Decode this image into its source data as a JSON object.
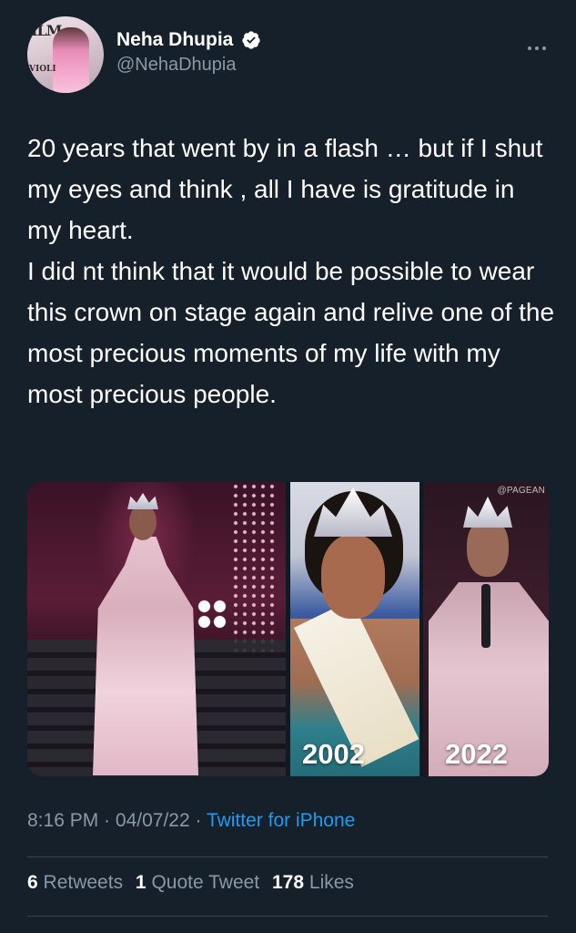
{
  "user": {
    "display_name": "Neha Dhupia",
    "handle": "@NehaDhupia",
    "avatar_cover_text": "ILM",
    "avatar_cover_sub": "VIOLI",
    "verified_icon": "verified-badge-icon",
    "more_icon": "more-horizontal-icon"
  },
  "tweet": {
    "paragraph1": "20 years that went by in a flash … but if I shut my eyes and think , all I have is gratitude in my heart.",
    "paragraph2": "I did nt think that it would be possible to wear this crown on stage again and relive one of the most precious moments of my life with my most precious people."
  },
  "media": {
    "watermark": "@PAGEAN",
    "year_left": "2002",
    "year_right": "2022"
  },
  "meta": {
    "time": "8:16 PM",
    "separator": " · ",
    "date": "04/07/22",
    "source": "Twitter for iPhone"
  },
  "stats": {
    "retweets_count": "6",
    "retweets_label": "Retweets",
    "quotes_count": "1",
    "quotes_label": "Quote Tweet",
    "likes_count": "178",
    "likes_label": "Likes"
  },
  "colors": {
    "background": "#15202b",
    "text": "#ffffff",
    "muted": "#8b98a5",
    "link": "#1d9bf0",
    "divider": "#38444d"
  }
}
